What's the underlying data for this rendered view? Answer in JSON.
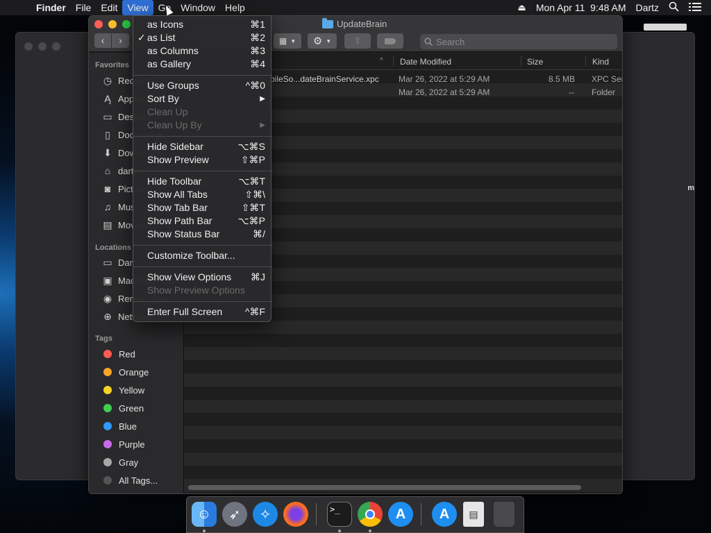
{
  "menubar": {
    "apple": "",
    "app": "Finder",
    "menus": [
      "File",
      "Edit",
      "View",
      "Go",
      "Window",
      "Help"
    ],
    "active_menu": "View",
    "clock": "Mon Apr 11  9:48 AM",
    "user": "Dartz",
    "eject_icon": "⏏"
  },
  "window": {
    "title": "UpdateBrain",
    "search_placeholder": "Search"
  },
  "sidebar": {
    "favorites_header": "Favorites",
    "favorites": [
      {
        "icon": "recents-icon",
        "label": "Recents"
      },
      {
        "icon": "applications-icon",
        "label": "Applications"
      },
      {
        "icon": "desktop-icon",
        "label": "Desktop"
      },
      {
        "icon": "documents-icon",
        "label": "Documents"
      },
      {
        "icon": "downloads-icon",
        "label": "Downloads"
      },
      {
        "icon": "home-icon",
        "label": "dartz"
      },
      {
        "icon": "pictures-icon",
        "label": "Pictures"
      },
      {
        "icon": "music-icon",
        "label": "Music"
      },
      {
        "icon": "movies-icon",
        "label": "Movies"
      }
    ],
    "locations_header": "Locations",
    "locations": [
      {
        "icon": "computer-icon",
        "label": "Dartz"
      },
      {
        "icon": "disk-icon",
        "label": "Macintosh HD"
      },
      {
        "icon": "disc-icon",
        "label": "Remote Disc"
      },
      {
        "icon": "network-icon",
        "label": "Network"
      }
    ],
    "tags_header": "Tags",
    "tags": [
      {
        "label": "Red",
        "color": "#ff5a52"
      },
      {
        "label": "Orange",
        "color": "#f7a42b"
      },
      {
        "label": "Yellow",
        "color": "#f5d326"
      },
      {
        "label": "Green",
        "color": "#3fcf4d"
      },
      {
        "label": "Blue",
        "color": "#2f9bff"
      },
      {
        "label": "Purple",
        "color": "#c76ae8"
      },
      {
        "label": "Gray",
        "color": "#a8a8a8"
      },
      {
        "label": "All Tags...",
        "color": "#555555"
      }
    ]
  },
  "columns": {
    "name": "",
    "date": "Date Modified",
    "size": "Size",
    "kind": "Kind"
  },
  "rows": [
    {
      "name": "bileSo...dateBrainService.xpc",
      "date": "Mar 26, 2022 at 5:29 AM",
      "size": "8.5 MB",
      "kind": "XPC Ser"
    },
    {
      "name": "",
      "date": "Mar 26, 2022 at 5:29 AM",
      "size": "--",
      "kind": "Folder"
    }
  ],
  "view_menu": {
    "items": [
      {
        "label": "as Icons",
        "shortcut": "⌘1",
        "checked": "",
        "enabled": true
      },
      {
        "label": "as List",
        "shortcut": "⌘2",
        "checked": "✓",
        "enabled": true
      },
      {
        "label": "as Columns",
        "shortcut": "⌘3",
        "checked": "",
        "enabled": true
      },
      {
        "label": "as Gallery",
        "shortcut": "⌘4",
        "checked": "",
        "enabled": true
      },
      {
        "label": "Use Groups",
        "shortcut": "^⌘0",
        "checked": "",
        "enabled": true
      },
      {
        "label": "Sort By",
        "shortcut": "▶",
        "checked": "",
        "enabled": true
      },
      {
        "label": "Clean Up",
        "shortcut": "",
        "checked": "",
        "enabled": false
      },
      {
        "label": "Clean Up By",
        "shortcut": "▶",
        "checked": "",
        "enabled": false
      },
      {
        "label": "Hide Sidebar",
        "shortcut": "⌥⌘S",
        "checked": "",
        "enabled": true
      },
      {
        "label": "Show Preview",
        "shortcut": "⇧⌘P",
        "checked": "",
        "enabled": true
      },
      {
        "label": "Hide Toolbar",
        "shortcut": "⌥⌘T",
        "checked": "",
        "enabled": true
      },
      {
        "label": "Show All Tabs",
        "shortcut": "⇧⌘\\",
        "checked": "",
        "enabled": true
      },
      {
        "label": "Show Tab Bar",
        "shortcut": "⇧⌘T",
        "checked": "",
        "enabled": true
      },
      {
        "label": "Show Path Bar",
        "shortcut": "⌥⌘P",
        "checked": "",
        "enabled": true
      },
      {
        "label": "Show Status Bar",
        "shortcut": "⌘/",
        "checked": "",
        "enabled": true
      },
      {
        "label": "Customize Toolbar...",
        "shortcut": "",
        "checked": "",
        "enabled": true
      },
      {
        "label": "Show View Options",
        "shortcut": "⌘J",
        "checked": "",
        "enabled": true
      },
      {
        "label": "Show Preview Options",
        "shortcut": "",
        "checked": "",
        "enabled": false
      },
      {
        "label": "Enter Full Screen",
        "shortcut": "^⌘F",
        "checked": "",
        "enabled": true
      }
    ]
  },
  "background_window": {
    "edge_text": "m"
  },
  "dock": {
    "apps": [
      {
        "icon": "finder-icon",
        "color": "#2d8cf0"
      },
      {
        "icon": "launchpad-icon",
        "color": "#6f7480"
      },
      {
        "icon": "safari-icon",
        "color": "#1e88e5"
      },
      {
        "icon": "firefox-icon",
        "color": "#ff6d1f"
      },
      {
        "icon": "terminal-icon",
        "color": "#1b1b1b"
      },
      {
        "icon": "chrome-icon",
        "color": "#e8e8e8"
      },
      {
        "icon": "app-store-icon",
        "color": "#1f8ef1"
      },
      {
        "icon": "app-store-downloads-icon",
        "color": "#1f8ef1"
      },
      {
        "icon": "document-icon",
        "color": "#e6e6e6"
      },
      {
        "icon": "trash-icon",
        "color": "#4a4a4c"
      }
    ]
  }
}
